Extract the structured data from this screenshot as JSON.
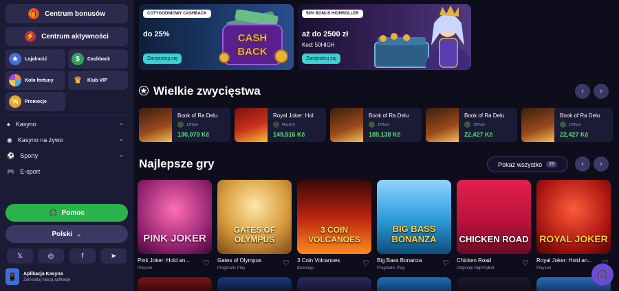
{
  "sidebar": {
    "bonus_center": "Centrum bonusów",
    "activity_center": "Centrum aktywności",
    "tiles": [
      {
        "label": "Lojalność",
        "icon": "loyalty-medal-icon"
      },
      {
        "label": "Cashback",
        "icon": "cashback-icon"
      },
      {
        "label": "Koło fortuny",
        "icon": "fortune-wheel-icon"
      },
      {
        "label": "Klub VIP",
        "icon": "vip-crown-icon"
      },
      {
        "label": "Promocje",
        "icon": "promotions-icon"
      }
    ],
    "nav": [
      {
        "label": "Kasyno",
        "icon": "casino-icon"
      },
      {
        "label": "Kasyno na żywo",
        "icon": "live-casino-icon"
      },
      {
        "label": "Sporty",
        "icon": "sports-ball-icon"
      },
      {
        "label": "E-sport",
        "icon": "esport-gamepad-icon"
      }
    ],
    "help": "Pomoc",
    "language": "Polski",
    "socials": [
      "x-icon",
      "instagram-icon",
      "facebook-icon",
      "telegram-icon"
    ],
    "app_title": "Aplikacja Kasyna",
    "app_sub": "Zainstaluj naszą aplikację"
  },
  "banners": [
    {
      "badge": "COTYGODNIOWY CASHBACK",
      "value": "do 25%",
      "code": "",
      "cta": "Zarejestruj się",
      "art": "CASH BACK"
    },
    {
      "badge": "50% BONUS HIGHROLLER",
      "value": "aż do 2500 zł",
      "code": "Kod: 50HIGH",
      "cta": "Zarejestruj się"
    }
  ],
  "big_wins": {
    "title": "Wielkie zwycięstwa",
    "items": [
      {
        "game": "Book of Ra Delu",
        "user": "13Haze",
        "amount": "130,079 Kč"
      },
      {
        "game": "Royal Joker: Hol",
        "user": "Mazel15",
        "amount": "149,516 Kč"
      },
      {
        "game": "Book of Ra Delu",
        "user": "13Haze",
        "amount": "189,138 Kč"
      },
      {
        "game": "Book of Ra Delu",
        "user": "13Haze",
        "amount": "22,427 Kč"
      },
      {
        "game": "Book of Ra Delu",
        "user": "13Haze",
        "amount": "22,427 Kč"
      }
    ]
  },
  "top_games": {
    "title": "Najlepsze gry",
    "show_all": "Pokaż wszystko",
    "count": "25",
    "items": [
      {
        "name": "Pink Joker: Hold an...",
        "provider": "Playson",
        "art": "PINK JOKER"
      },
      {
        "name": "Gates of Olympus",
        "provider": "Pragmatic Play",
        "art": "GATES OF OLYMPUS"
      },
      {
        "name": "3 Coin Volcanoes",
        "provider": "Booongo",
        "art": "3 COIN VOLCANOES"
      },
      {
        "name": "Big Bass Bonanza",
        "provider": "Pragmatic Play",
        "art": "BIG BASS BONANZA"
      },
      {
        "name": "Chicken Road",
        "provider": "Originały HighFlyBet",
        "art": "CHICKEN ROAD"
      },
      {
        "name": "Royal Joker: Hold an...",
        "provider": "Playson",
        "art": "ROYAL JOKER"
      }
    ]
  }
}
